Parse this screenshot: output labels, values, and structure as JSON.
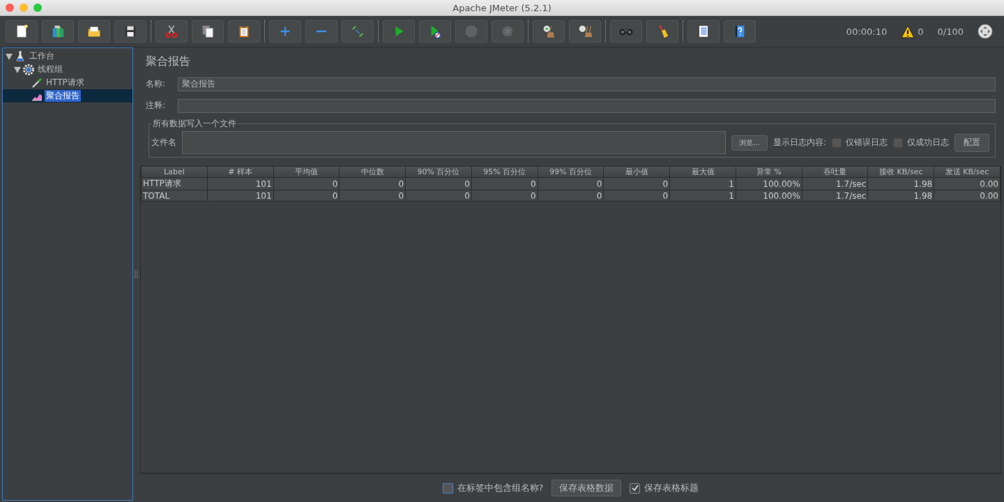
{
  "window": {
    "title": "Apache JMeter (5.2.1)"
  },
  "toolbar": {
    "buttons": [
      {
        "disabled": false
      },
      {
        "disabled": false
      },
      {
        "disabled": false
      },
      {
        "disabled": false
      },
      {
        "disabled": false
      },
      {
        "disabled": false
      },
      {
        "disabled": false
      },
      {
        "disabled": false
      },
      {
        "disabled": false
      },
      {
        "disabled": false
      },
      {
        "disabled": false
      },
      {
        "disabled": false
      },
      {
        "disabled": true
      },
      {
        "disabled": true
      },
      {
        "disabled": false
      },
      {
        "disabled": false
      },
      {
        "disabled": false
      },
      {
        "disabled": false
      },
      {
        "disabled": false
      },
      {
        "disabled": false
      }
    ],
    "timer": "00:00:10",
    "warnings": "0",
    "threads": "0/100"
  },
  "tree": [
    {
      "label": "工作台",
      "kind": "workbench",
      "expanded": true,
      "selected": false,
      "children": [
        {
          "label": "线程组",
          "kind": "thread-group",
          "expanded": true,
          "selected": false,
          "children": [
            {
              "label": "HTTP请求",
              "kind": "sampler",
              "selected": false
            },
            {
              "label": "聚合报告",
              "kind": "listener",
              "selected": true
            }
          ]
        }
      ]
    }
  ],
  "report": {
    "title": "聚合报告",
    "fields": [
      {
        "label": "名称:",
        "value": "聚合报告"
      },
      {
        "label": "注释:"
      }
    ],
    "file_group": {
      "title": "所有数据写入一个文件",
      "file_label": "文件名",
      "browse_button": "浏览...",
      "log_label": "显示日志内容:",
      "checkboxes": [
        {
          "label": "仅错误日志",
          "checked": false
        },
        {
          "label": "仅成功日志",
          "checked": false
        }
      ],
      "config_button": "配置"
    },
    "table": {
      "columns": [
        "Label",
        "# 样本",
        "平均值",
        "中位数",
        "90% 百分位",
        "95% 百分位",
        "99% 百分位",
        "最小值",
        "最大值",
        "异常 %",
        "吞吐量",
        "接收 KB/sec",
        "发送 KB/sec"
      ],
      "rows": [
        [
          "HTTP请求",
          "101",
          "0",
          "0",
          "0",
          "0",
          "0",
          "0",
          "1",
          "100.00%",
          "1.7/sec",
          "1.98",
          "0.00"
        ],
        [
          "TOTAL",
          "101",
          "0",
          "0",
          "0",
          "0",
          "0",
          "0",
          "1",
          "100.00%",
          "1.7/sec",
          "1.98",
          "0.00"
        ]
      ]
    },
    "footer": {
      "include_group": {
        "label": "在标签中包含组名称?",
        "checked": false
      },
      "save_button": "保存表格数据",
      "save_header": {
        "label": "保存表格标题",
        "checked": true
      }
    }
  }
}
